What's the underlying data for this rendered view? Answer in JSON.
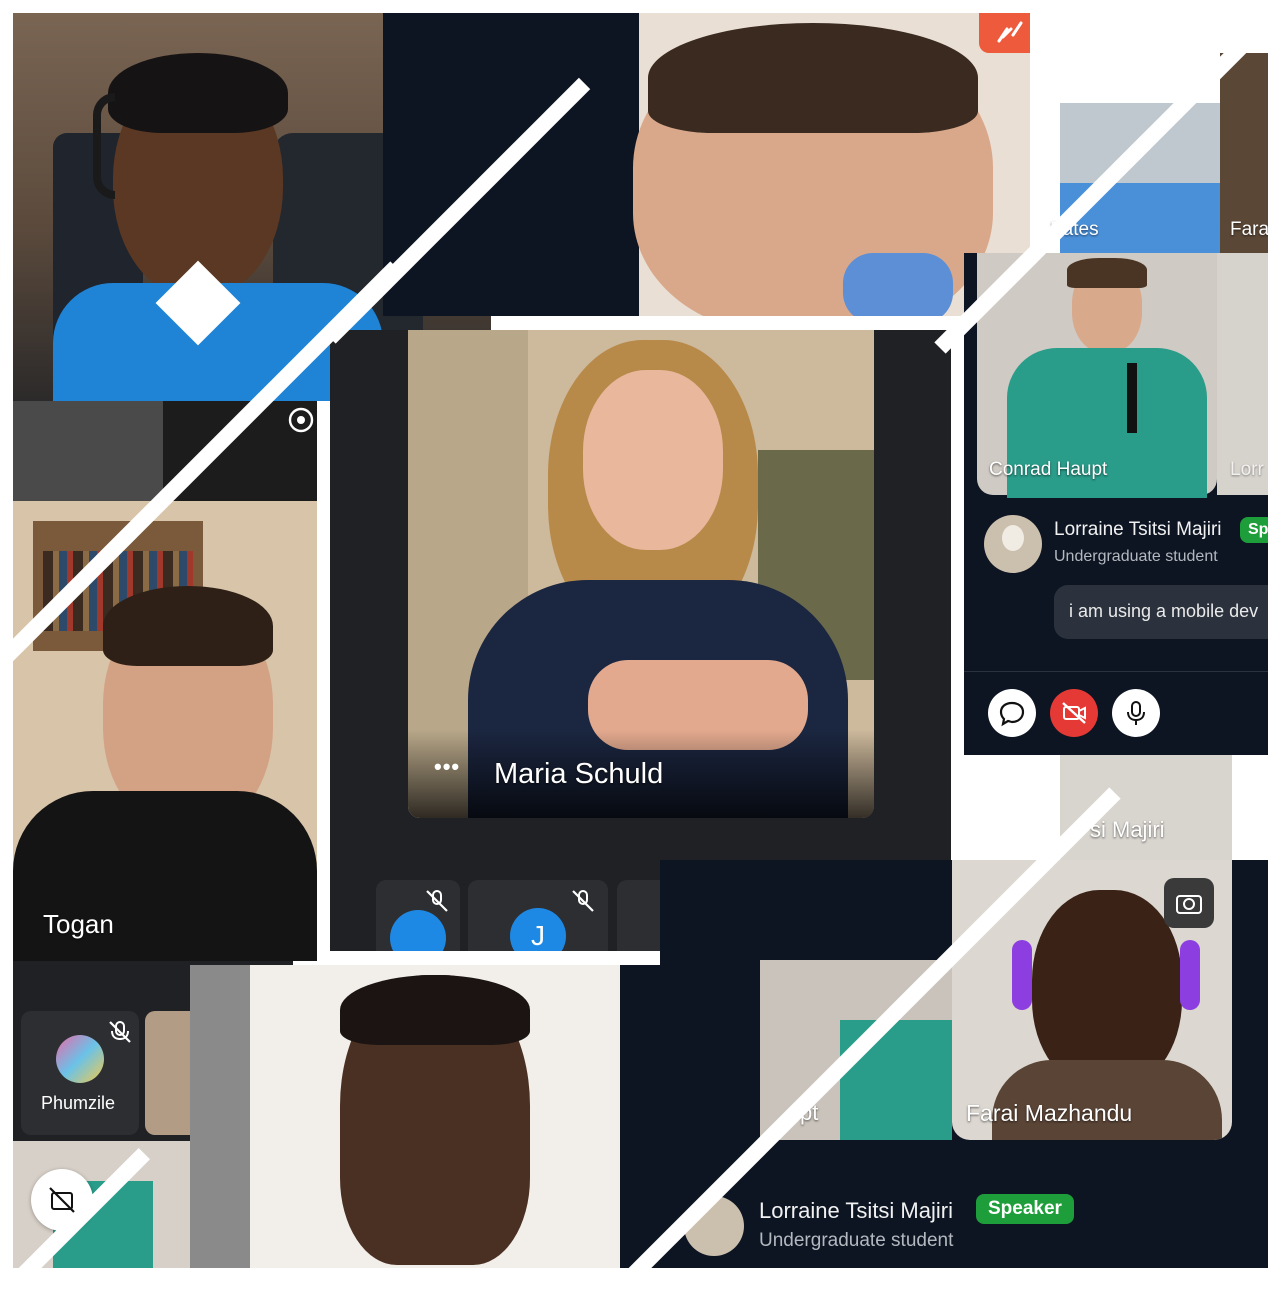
{
  "collage": {
    "tiles": {
      "top_left": {
        "bg_color": "#6b5a4a"
      },
      "top_center": {
        "bg_color": "#e9dcd0",
        "corner_icon": "link-off-icon",
        "accent": "#ee5a3c"
      },
      "maria": {
        "name": "Maria Schuld",
        "more_icon": "more-dots-icon"
      },
      "togan": {
        "name": "Togan"
      },
      "phumzile": {
        "name": "Phumzile"
      },
      "right_top": {
        "partial_name_a": "Bates",
        "partial_name_b": "Fara"
      },
      "conrad": {
        "name": "Conrad Haupt",
        "partial_next": "Lorr"
      },
      "chat_top": {
        "name": "Lorraine Tsitsi Majiri",
        "role": "Undergraduate student",
        "badge": "Sp",
        "message": "i am using a mobile dev"
      },
      "bottom_right_partial": {
        "text": "si Majiri"
      },
      "farai": {
        "name": "Farai Mazhandu",
        "partial_left": "pt"
      },
      "chat_bottom": {
        "name": "Lorraine Tsitsi Majiri",
        "role": "Undergraduate student",
        "badge": "Speaker"
      },
      "strip": {
        "avatar_letter": "J"
      }
    },
    "colors": {
      "speaker_green": "#1e9e3a",
      "danger_red": "#e53935",
      "meet_dark": "#202124"
    }
  }
}
